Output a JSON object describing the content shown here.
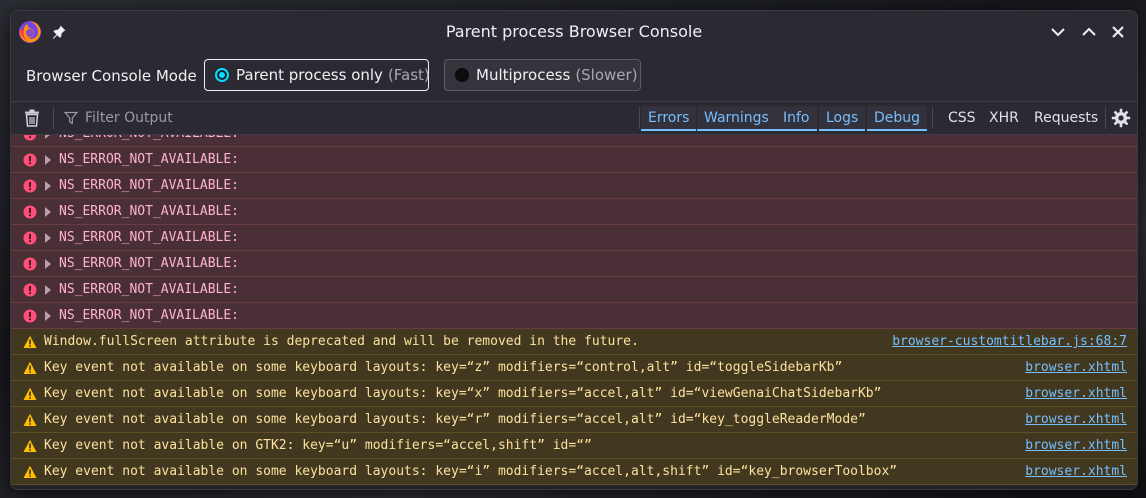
{
  "window": {
    "title": "Parent process Browser Console"
  },
  "mode_bar": {
    "label": "Browser Console Mode",
    "options": [
      {
        "label": "Parent process only",
        "hint": "(Fast)",
        "selected": true
      },
      {
        "label": "Multiprocess",
        "hint": "(Slower)",
        "selected": false
      }
    ]
  },
  "toolbar": {
    "filter_placeholder": "Filter Output",
    "log_levels": [
      "Errors",
      "Warnings",
      "Info",
      "Logs",
      "Debug"
    ],
    "network_filters": [
      "CSS",
      "XHR",
      "Requests"
    ]
  },
  "messages": [
    {
      "level": "error",
      "text": "NS_ERROR_NOT_AVAILABLE:"
    },
    {
      "level": "error",
      "text": "NS_ERROR_NOT_AVAILABLE:"
    },
    {
      "level": "error",
      "text": "NS_ERROR_NOT_AVAILABLE:"
    },
    {
      "level": "error",
      "text": "NS_ERROR_NOT_AVAILABLE:"
    },
    {
      "level": "error",
      "text": "NS_ERROR_NOT_AVAILABLE:"
    },
    {
      "level": "error",
      "text": "NS_ERROR_NOT_AVAILABLE:"
    },
    {
      "level": "error",
      "text": "NS_ERROR_NOT_AVAILABLE:"
    },
    {
      "level": "error",
      "text": "NS_ERROR_NOT_AVAILABLE:"
    },
    {
      "level": "warning",
      "text": "Window.fullScreen attribute is deprecated and will be removed in the future.",
      "source": "browser-customtitlebar.js:68:7"
    },
    {
      "level": "warning",
      "text": "Key event not available on some keyboard layouts: key=“z” modifiers=“control,alt” id=“toggleSidebarKb”",
      "source": "browser.xhtml"
    },
    {
      "level": "warning",
      "text": "Key event not available on some keyboard layouts: key=“x” modifiers=“accel,alt” id=“viewGenaiChatSidebarKb”",
      "source": "browser.xhtml"
    },
    {
      "level": "warning",
      "text": "Key event not available on some keyboard layouts: key=“r” modifiers=“accel,alt” id=“key_toggleReaderMode”",
      "source": "browser.xhtml"
    },
    {
      "level": "warning",
      "text": "Key event not available on GTK2: key=“u” modifiers=“accel,shift” id=“”",
      "source": "browser.xhtml"
    },
    {
      "level": "warning",
      "text": "Key event not available on some keyboard layouts: key=“i” modifiers=“accel,alt,shift” id=“key_browserToolbox”",
      "source": "browser.xhtml"
    }
  ],
  "colors": {
    "error_bg": "#4b2f36",
    "error_text": "#ffb3d2",
    "warning_bg": "#42381f",
    "warning_text": "#fce19f",
    "link": "#75bfff",
    "accent": "#00ddff"
  }
}
